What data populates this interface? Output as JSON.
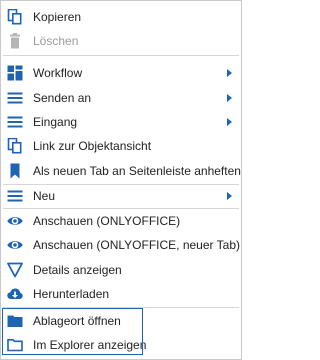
{
  "context_menu": {
    "items": [
      {
        "label": "Kopieren",
        "icon": "copy-icon",
        "state": "enabled"
      },
      {
        "label": "Löschen",
        "icon": "trash-icon",
        "state": "disabled"
      },
      {
        "label": "Workflow",
        "icon": "grid-icon",
        "state": "enabled",
        "submenu": true
      },
      {
        "label": "Senden an",
        "icon": "hamburger-icon",
        "state": "enabled",
        "submenu": true
      },
      {
        "label": "Eingang",
        "icon": "hamburger-icon",
        "state": "enabled",
        "submenu": true
      },
      {
        "label": "Link zur Objektansicht",
        "icon": "copy-icon",
        "state": "enabled"
      },
      {
        "label": "Als neuen Tab an Seitenleiste anheften",
        "icon": "bookmark-icon",
        "state": "enabled"
      },
      {
        "label": "Neu",
        "icon": "hamburger-icon",
        "state": "enabled",
        "submenu": true
      },
      {
        "label": "Anschauen (ONLYOFFICE)",
        "icon": "eye-icon",
        "state": "enabled"
      },
      {
        "label": "Anschauen (ONLYOFFICE, neuer Tab)",
        "icon": "eye-icon",
        "state": "enabled"
      },
      {
        "label": "Details anzeigen",
        "icon": "filter-triangle-icon",
        "state": "enabled"
      },
      {
        "label": "Herunterladen",
        "icon": "cloud-download-icon",
        "state": "enabled"
      },
      {
        "label": "Ablageort öffnen",
        "icon": "folder-icon",
        "state": "enabled"
      },
      {
        "label": "Im Explorer anzeigen",
        "icon": "folder-outline-icon",
        "state": "enabled"
      }
    ]
  },
  "colors": {
    "icon_blue": "#1e64b4",
    "disabled_gray": "#9a9a9a",
    "text": "#222222",
    "separator": "#d6d6d6"
  }
}
